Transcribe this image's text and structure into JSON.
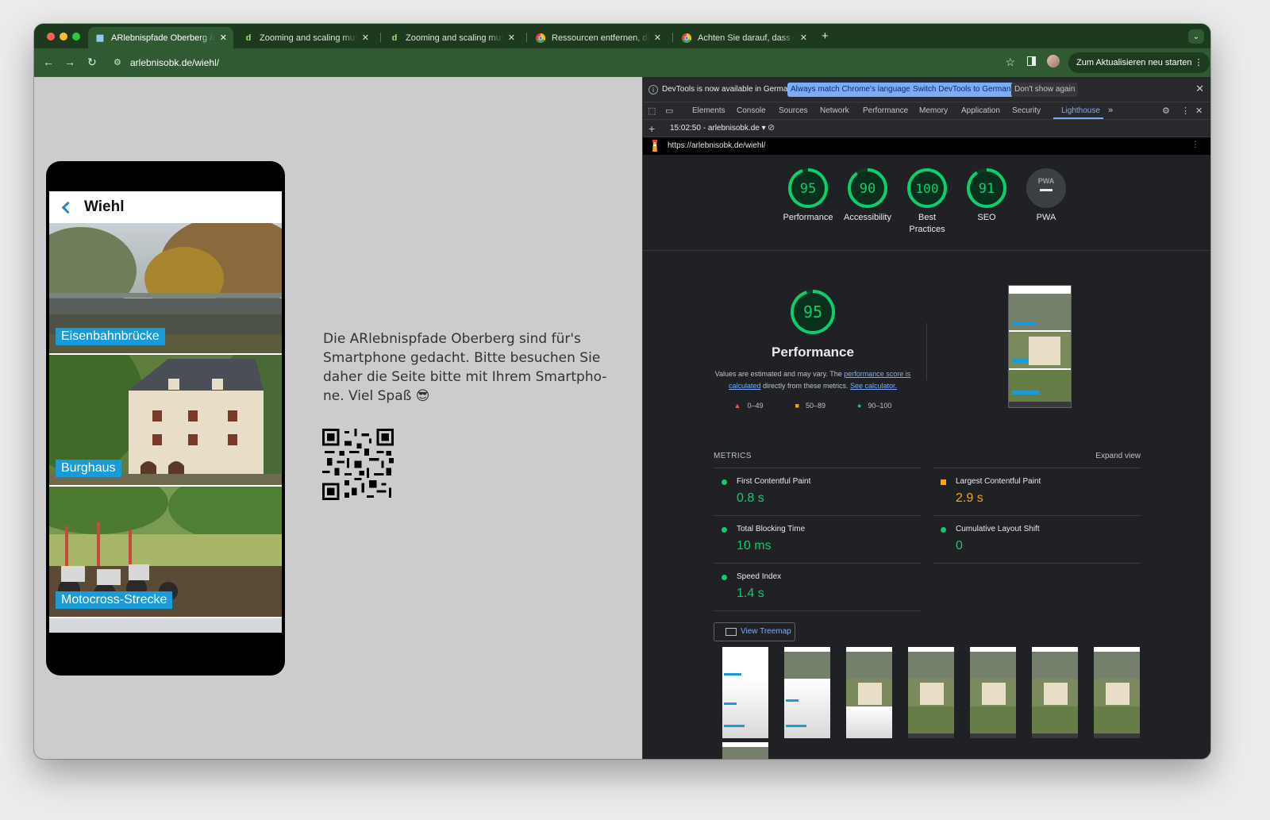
{
  "tabs": [
    {
      "title": "ARlebnispfade Oberberg // Wiehl",
      "active": true,
      "favicon": "arlebnispfade-favicon"
    },
    {
      "title": "Zooming and scaling must not be disabled",
      "active": false,
      "favicon": "deque-favicon"
    },
    {
      "title": "Zooming and scaling must not be disabled",
      "active": false,
      "favicon": "deque-favicon"
    },
    {
      "title": "Ressourcen entfernen, die das Rendering blockieren",
      "active": false,
      "favicon": "chrome-favicon"
    },
    {
      "title": "Achten Sie darauf, dass der Text",
      "active": false,
      "favicon": "chrome-favicon"
    }
  ],
  "toolbar": {
    "url": "arlebnisobk.de/wiehl/",
    "update_label": "Zum Aktualisieren neu starten"
  },
  "page": {
    "phone_title": "Wiehl",
    "spots": [
      {
        "label": "Eisenbahnbrücke"
      },
      {
        "label": "Burghaus"
      },
      {
        "label": "Motocross-Strecke"
      }
    ],
    "info_text": "Die ARlebnispfade Oberberg sind für's Smartphone gedacht. Bitte besuchen Sie daher die Seite bitte mit Ihrem Smartpho-ne. Viel Spaß 😎"
  },
  "devtools": {
    "infobar": {
      "message": "DevTools is now available in German!",
      "btn_match": "Always match Chrome's language",
      "btn_switch": "Switch DevTools to German",
      "btn_dismiss": "Don't show again"
    },
    "tabs": [
      "Elements",
      "Console",
      "Sources",
      "Network",
      "Performance",
      "Memory",
      "Application",
      "Security",
      "Lighthouse"
    ],
    "active_tab": "Lighthouse",
    "report_select": "15:02:50 - arlebnisobk.de",
    "report_url": "https://arlebnisobk.de/wiehl/",
    "scores": [
      {
        "label": "Performance",
        "value": "95",
        "fraction": 0.95
      },
      {
        "label": "Accessibility",
        "value": "90",
        "fraction": 0.9
      },
      {
        "label": "Best\nPractices",
        "value": "100",
        "fraction": 1.0
      },
      {
        "label": "SEO",
        "value": "91",
        "fraction": 0.91
      },
      {
        "label": "PWA",
        "value": "PWA",
        "fraction": 0
      }
    ],
    "performance": {
      "score": "95",
      "fraction": 0.95,
      "title": "Performance",
      "desc_1": "Values are estimated and may vary. The ",
      "desc_link_1": "performance score is calculated",
      "desc_2": " directly from these metrics. ",
      "desc_link_2": "See calculator.",
      "legend": [
        {
          "symbol": "▲",
          "range": "0–49",
          "color": "#ff4e42"
        },
        {
          "symbol": "■",
          "range": "50–89",
          "color": "#ffa400"
        },
        {
          "symbol": "●",
          "range": "90–100",
          "color": "#0cce6b"
        }
      ]
    },
    "metrics_header": "METRICS",
    "expand_view": "Expand view",
    "metrics": [
      {
        "name": "First Contentful Paint",
        "value": "0.8 s",
        "rating": "pass"
      },
      {
        "name": "Largest Contentful Paint",
        "value": "2.9 s",
        "rating": "average"
      },
      {
        "name": "Total Blocking Time",
        "value": "10 ms",
        "rating": "pass"
      },
      {
        "name": "Cumulative Layout Shift",
        "value": "0",
        "rating": "pass"
      },
      {
        "name": "Speed Index",
        "value": "1.4 s",
        "rating": "pass"
      }
    ],
    "view_treemap": "View Treemap"
  },
  "colors": {
    "pass": "#0cce6b",
    "average": "#ffa400",
    "fail": "#ff4e42",
    "accent": "#7cacf8",
    "chrome_frame": "#2f5a32",
    "label_bg": "#1a9ad6"
  }
}
